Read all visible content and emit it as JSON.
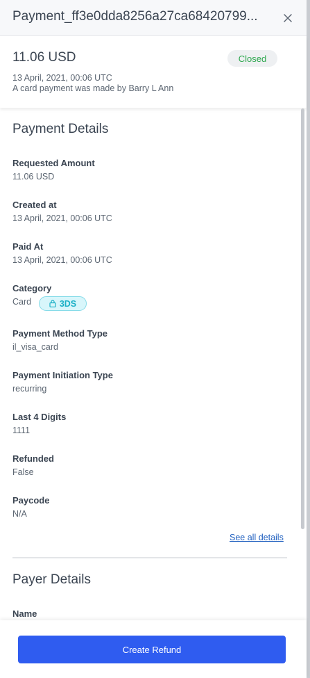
{
  "header": {
    "title": "Payment_ff3e0dda8256a27ca68420799...",
    "close_icon": "close-icon"
  },
  "summary": {
    "amount": "11.06 USD",
    "status": "Closed",
    "status_color": "#2fa84f",
    "date": "13 April, 2021, 00:06 UTC",
    "description": "A card payment was made by Barry L Ann"
  },
  "payment_details": {
    "title": "Payment Details",
    "fields": [
      {
        "label": "Requested Amount",
        "value": "11.06 USD"
      },
      {
        "label": "Created at",
        "value": "13 April, 2021, 00:06 UTC"
      },
      {
        "label": "Paid At",
        "value": "13 April, 2021, 00:06 UTC"
      },
      {
        "label": "Category",
        "value": "Card",
        "tag": "3DS",
        "tag_icon": "lock-icon"
      },
      {
        "label": "Payment Method Type",
        "value": "il_visa_card"
      },
      {
        "label": "Payment Initiation Type",
        "value": "recurring"
      },
      {
        "label": "Last 4 Digits",
        "value": "1111"
      },
      {
        "label": "Refunded",
        "value": "False"
      },
      {
        "label": "Paycode",
        "value": "N/A"
      }
    ],
    "see_all": "See all details"
  },
  "payer_details": {
    "title": "Payer Details",
    "fields": [
      {
        "label": "Name"
      }
    ]
  },
  "footer": {
    "button_label": "Create Refund",
    "button_color": "#2f5cf0"
  }
}
